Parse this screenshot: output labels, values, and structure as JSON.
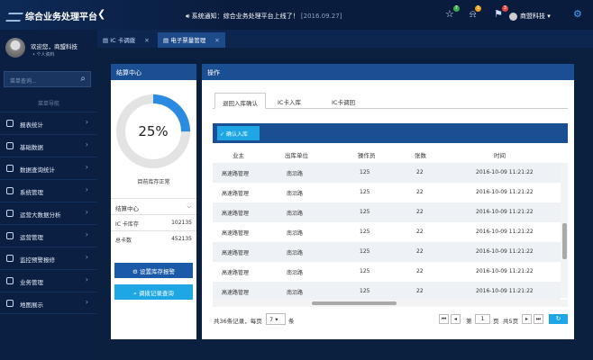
{
  "header": {
    "app_title": "综合业务处理平台",
    "notice": "系统通知：综合业务处理平台上线了！",
    "notice_date": "[2016.09.27]",
    "badges": {
      "star": "7",
      "bell": "1",
      "flag": "3"
    },
    "user_name": "商盟科技",
    "colors": {
      "star_badge": "#3bb04f",
      "bell_badge": "#f0a21c",
      "flag_badge": "#e9463c",
      "accent": "#1ea7e4"
    }
  },
  "tabs": [
    {
      "label": "IC 卡调拨",
      "active": false
    },
    {
      "label": "电子票量管理",
      "active": true
    }
  ],
  "sidebar": {
    "welcome": "欢迎您，商盟科技",
    "user_sub": "• 个人资料",
    "search_placeholder": "菜单查询...",
    "nav_title": "菜单导航",
    "items": [
      {
        "label": "报表统计",
        "icon": "chart-icon"
      },
      {
        "label": "基础数据",
        "icon": "database-icon"
      },
      {
        "label": "数据查询统计",
        "icon": "query-icon"
      },
      {
        "label": "系统管理",
        "icon": "settings-icon"
      },
      {
        "label": "运营大数据分析",
        "icon": "analytics-icon"
      },
      {
        "label": "运营管理",
        "icon": "operations-icon"
      },
      {
        "label": "监控预警报修",
        "icon": "monitor-icon"
      },
      {
        "label": "业务管理",
        "icon": "business-icon"
      },
      {
        "label": "地图展示",
        "icon": "map-icon"
      }
    ]
  },
  "settlement": {
    "title": "结算中心",
    "gauge_percent": 25,
    "gauge_text": "25%",
    "gauge_label": "目前库存正常",
    "section_title": "结算中心",
    "rows": [
      {
        "label": "IC 卡库存",
        "value": "102135"
      },
      {
        "label": "总卡数",
        "value": "452135"
      }
    ],
    "btn_alert": "设置库存报警",
    "btn_query": "调拨记录查询"
  },
  "operations": {
    "title": "操作",
    "subtabs": [
      "退回入库确认",
      "IC卡入库",
      "IC卡调回"
    ],
    "action_button": "确认入库",
    "columns": [
      "业主",
      "出库单位",
      "操作员",
      "张数",
      "时间"
    ],
    "rows": [
      [
        "高速路管理",
        "南沿路",
        "125",
        "22",
        "2016-10-09 11:21:22"
      ],
      [
        "高速路管理",
        "南沿路",
        "125",
        "22",
        "2016-10-09 11:21:22"
      ],
      [
        "高速路管理",
        "南沿路",
        "125",
        "22",
        "2016-10-09 11:21:22"
      ],
      [
        "高速路管理",
        "南沿路",
        "125",
        "22",
        "2016-10-09 11:21:22"
      ],
      [
        "高速路管理",
        "南沿路",
        "125",
        "22",
        "2016-10-09 11:21:22"
      ],
      [
        "高速路管理",
        "南沿路",
        "125",
        "22",
        "2016-10-09 11:21:22"
      ],
      [
        "高速路管理",
        "南沿路",
        "125",
        "22",
        "2016-10-09 11:21:22"
      ]
    ],
    "footer": {
      "total_text": "共36条记录，每页",
      "page_size": "7",
      "per_unit": "条",
      "page_prefix": "第",
      "page_value": "1",
      "page_suffix": "页",
      "total_pages": "共5页"
    }
  }
}
